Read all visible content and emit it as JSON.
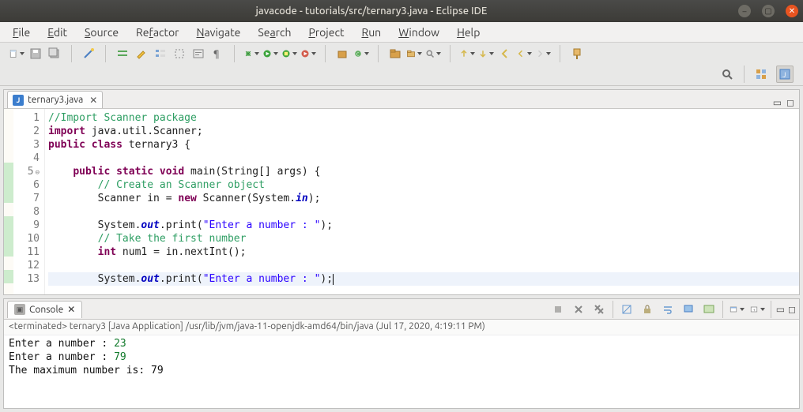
{
  "window": {
    "title": "javacode - tutorials/src/ternary3.java - Eclipse IDE"
  },
  "menu": [
    "File",
    "Edit",
    "Source",
    "Refactor",
    "Navigate",
    "Search",
    "Project",
    "Run",
    "Window",
    "Help"
  ],
  "menu_underline_idx": [
    0,
    0,
    0,
    2,
    0,
    2,
    0,
    0,
    0,
    0
  ],
  "editor": {
    "tab_label": "ternary3.java",
    "lines": [
      {
        "n": "1",
        "segs": [
          {
            "t": "//Import Scanner package",
            "c": "cm"
          }
        ]
      },
      {
        "n": "2",
        "segs": [
          {
            "t": "import",
            "c": "kw"
          },
          {
            "t": " java.util.Scanner;",
            "c": ""
          }
        ]
      },
      {
        "n": "3",
        "segs": [
          {
            "t": "public class",
            "c": "kw"
          },
          {
            "t": " ternary3 {",
            "c": ""
          }
        ]
      },
      {
        "n": "4",
        "segs": [
          {
            "t": "",
            "c": ""
          }
        ]
      },
      {
        "n": "5",
        "fold": true,
        "segs": [
          {
            "t": "    ",
            "c": ""
          },
          {
            "t": "public static void",
            "c": "kw"
          },
          {
            "t": " main(String[] args) {",
            "c": ""
          }
        ]
      },
      {
        "n": "6",
        "segs": [
          {
            "t": "        ",
            "c": ""
          },
          {
            "t": "// Create an Scanner object",
            "c": "cm"
          }
        ]
      },
      {
        "n": "7",
        "segs": [
          {
            "t": "        Scanner in = ",
            "c": ""
          },
          {
            "t": "new",
            "c": "kw"
          },
          {
            "t": " Scanner(System.",
            "c": ""
          },
          {
            "t": "in",
            "c": "fi"
          },
          {
            "t": ");",
            "c": ""
          }
        ]
      },
      {
        "n": "8",
        "segs": [
          {
            "t": "",
            "c": ""
          }
        ]
      },
      {
        "n": "9",
        "segs": [
          {
            "t": "        System.",
            "c": ""
          },
          {
            "t": "out",
            "c": "fi"
          },
          {
            "t": ".print(",
            "c": ""
          },
          {
            "t": "\"Enter a number : \"",
            "c": "st"
          },
          {
            "t": ");",
            "c": ""
          }
        ]
      },
      {
        "n": "10",
        "segs": [
          {
            "t": "        ",
            "c": ""
          },
          {
            "t": "// Take the first number",
            "c": "cm"
          }
        ]
      },
      {
        "n": "11",
        "segs": [
          {
            "t": "        ",
            "c": ""
          },
          {
            "t": "int",
            "c": "kw"
          },
          {
            "t": " num1 = in.nextInt();",
            "c": ""
          }
        ]
      },
      {
        "n": "12",
        "segs": [
          {
            "t": "",
            "c": ""
          }
        ]
      },
      {
        "n": "13",
        "cur": true,
        "segs": [
          {
            "t": "        System.",
            "c": ""
          },
          {
            "t": "out",
            "c": "fi"
          },
          {
            "t": ".print(",
            "c": ""
          },
          {
            "t": "\"Enter a number : \"",
            "c": "st"
          },
          {
            "t": ");",
            "c": ""
          }
        ]
      }
    ]
  },
  "console": {
    "tab_label": "Console",
    "status": "<terminated> ternary3 [Java Application] /usr/lib/jvm/java-11-openjdk-amd64/bin/java (Jul 17, 2020, 4:19:11 PM)",
    "lines": [
      {
        "prompt": "Enter a number : ",
        "input": "23"
      },
      {
        "prompt": "Enter a number : ",
        "input": "79"
      },
      {
        "prompt": "The maximum number is: 79",
        "input": ""
      }
    ]
  }
}
